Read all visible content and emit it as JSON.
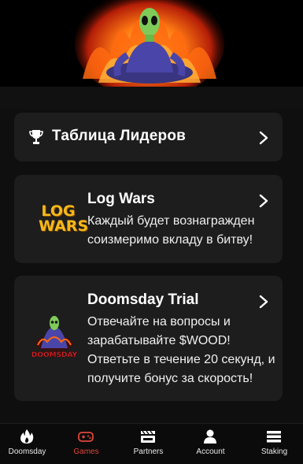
{
  "leaderboard": {
    "title": "Таблица Лидеров"
  },
  "games": [
    {
      "title": "Log Wars",
      "description": "Каждый будет вознагражден соизмеримо вкладу в битву!",
      "logo_line1": "LOG",
      "logo_line2": "WARS",
      "logo_text": "LOG WARS"
    },
    {
      "title": "Doomsday Trial",
      "description": "Отвечайте на вопросы и зарабатывайте $WOOD! Ответьте в течение 20 секунд, и получите бонус за скорость!",
      "logo_text": "DOOMSDAY"
    }
  ],
  "nav": {
    "items": [
      {
        "label": "Doomsday",
        "icon": "flame-icon",
        "active": false
      },
      {
        "label": "Games",
        "icon": "gamepad-icon",
        "active": true
      },
      {
        "label": "Partners",
        "icon": "partners-icon",
        "active": false
      },
      {
        "label": "Account",
        "icon": "user-icon",
        "active": false
      },
      {
        "label": "Staking",
        "icon": "stack-icon",
        "active": false
      }
    ],
    "active_color": "#e0453a"
  },
  "colors": {
    "background": "#0f0f0f",
    "card": "#1d1d1d",
    "logwars_gold": "#f6b81c",
    "doomsday_red": "#d0262a"
  }
}
